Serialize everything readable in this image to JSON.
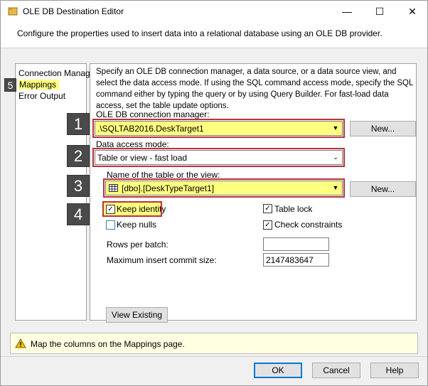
{
  "window": {
    "title": "OLE DB Destination Editor",
    "minimize_glyph": "—",
    "maximize_glyph": "☐",
    "close_glyph": "✕"
  },
  "header": {
    "text": "Configure the properties used to insert data into a relational database using an OLE DB provider."
  },
  "nav": {
    "items": [
      {
        "label": "Connection Manager"
      },
      {
        "label": "Mappings"
      },
      {
        "label": "Error Output"
      }
    ]
  },
  "main": {
    "description": "Specify an OLE DB connection manager, a data source, or a data source view, and select the data access mode. If using the SQL command access mode, specify the SQL command either by typing the query or by using Query Builder. For fast-load data access, set the table update options.",
    "connection_label": "OLE DB connection manager:",
    "connection_value": ".\\SQLTAB2016.DeskTarget1",
    "new_label": "New...",
    "access_mode_label": "Data access mode:",
    "access_mode_value": "Table or view - fast load",
    "table_label": "Name of the table or the view:",
    "table_value": "[dbo].[DeskTypeTarget1]",
    "keep_identity_label": "Keep identity",
    "keep_nulls_label": "Keep nulls",
    "table_lock_label": "Table lock",
    "check_constraints_label": "Check constraints",
    "check_glyph": "✓",
    "rows_per_batch_label": "Rows per batch:",
    "rows_per_batch_value": "",
    "max_commit_label": "Maximum insert commit size:",
    "max_commit_value": "2147483647",
    "view_existing_label": "View Existing"
  },
  "callouts": [
    "1",
    "2",
    "3",
    "4",
    "5"
  ],
  "message": {
    "text": "Map the columns on the Mappings page.",
    "icon": "warning-icon"
  },
  "footer": {
    "ok_label": "OK",
    "cancel_label": "Cancel",
    "help_label": "Help"
  },
  "colors": {
    "highlight": "#ffff80",
    "callout_box": "#b8323b",
    "callout_bg": "#4a4a4a",
    "accent": "#0078d7"
  }
}
